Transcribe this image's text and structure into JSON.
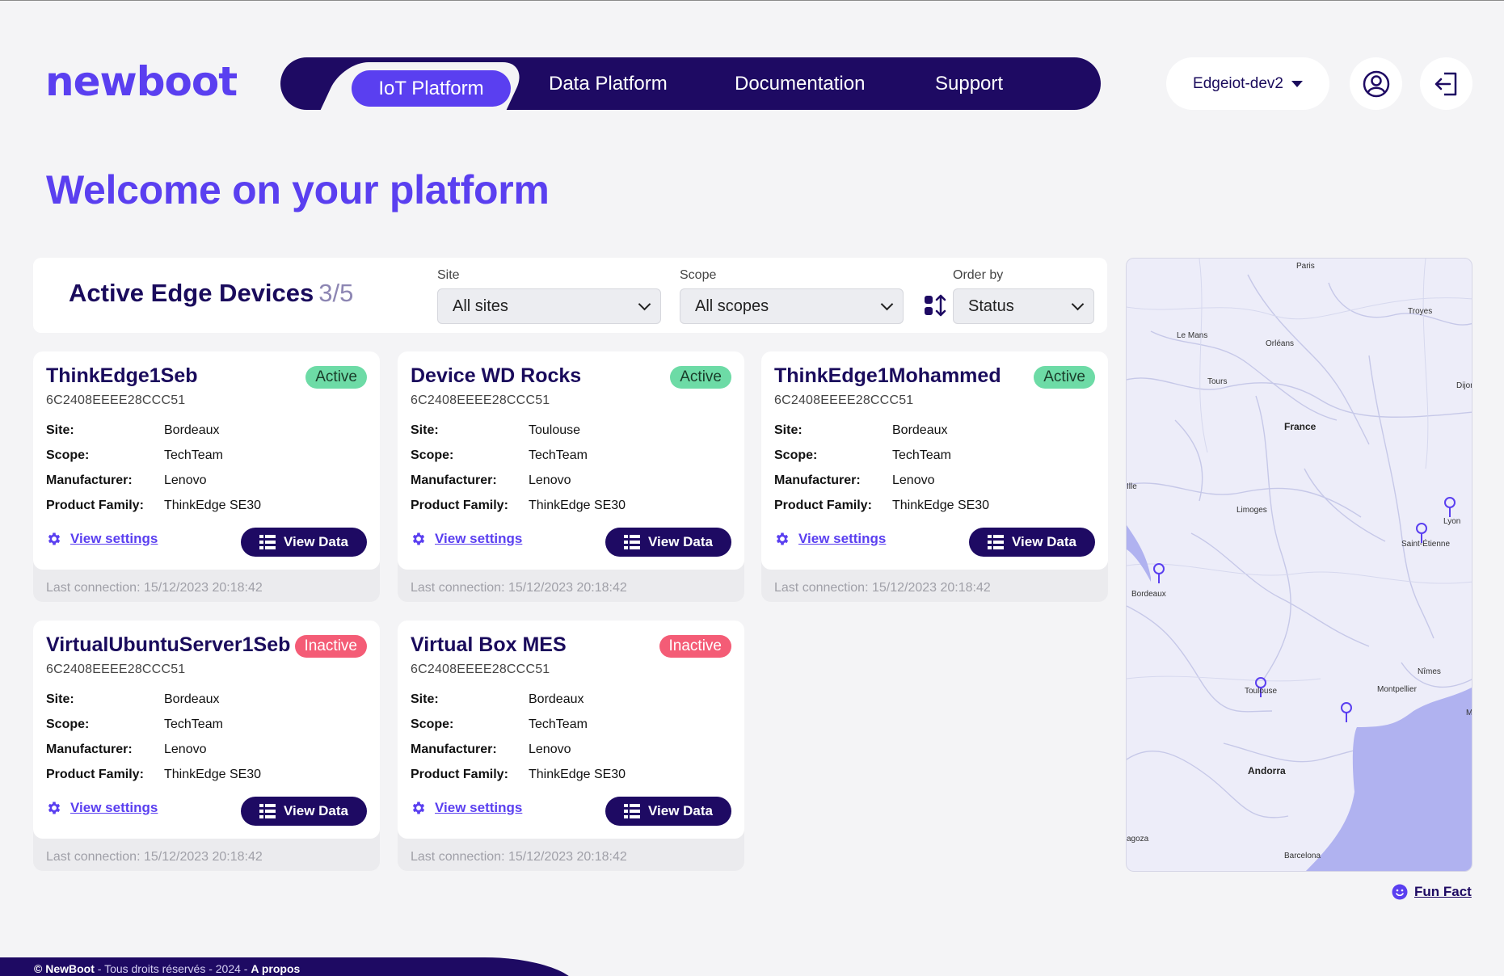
{
  "header": {
    "logo": "newboot",
    "nav": {
      "active": "IoT Platform",
      "items": [
        "Data Platform",
        "Documentation",
        "Support"
      ]
    },
    "environment": "Edgeiot-dev2"
  },
  "page_title": "Welcome on your platform",
  "filters": {
    "title": "Active Edge Devices",
    "count": "3/5",
    "site_label": "Site",
    "site_value": "All sites",
    "scope_label": "Scope",
    "scope_value": "All scopes",
    "order_label": "Order by",
    "order_value": "Status"
  },
  "card_labels": {
    "site": "Site:",
    "scope": "Scope:",
    "manufacturer": "Manufacturer:",
    "product_family": "Product Family:",
    "view_settings": "View settings",
    "view_data": "View Data"
  },
  "devices": [
    {
      "name": "ThinkEdge1Seb",
      "status": "Active",
      "id": "6C2408EEEE28CCC51",
      "site": "Bordeaux",
      "scope": "TechTeam",
      "manufacturer": "Lenovo",
      "product_family": "ThinkEdge SE30",
      "last_connection": "Last connection: 15/12/2023 20:18:42"
    },
    {
      "name": "Device WD Rocks",
      "status": "Active",
      "id": "6C2408EEEE28CCC51",
      "site": "Toulouse",
      "scope": "TechTeam",
      "manufacturer": "Lenovo",
      "product_family": "ThinkEdge SE30",
      "last_connection": "Last connection: 15/12/2023 20:18:42"
    },
    {
      "name": "ThinkEdge1Mohammed",
      "status": "Active",
      "id": "6C2408EEEE28CCC51",
      "site": "Bordeaux",
      "scope": "TechTeam",
      "manufacturer": "Lenovo",
      "product_family": "ThinkEdge SE30",
      "last_connection": "Last connection: 15/12/2023 20:18:42"
    },
    {
      "name": "VirtualUbuntuServer1Seb",
      "status": "Inactive",
      "id": "6C2408EEEE28CCC51",
      "site": "Bordeaux",
      "scope": "TechTeam",
      "manufacturer": "Lenovo",
      "product_family": "ThinkEdge SE30",
      "last_connection": "Last connection: 15/12/2023 20:18:42"
    },
    {
      "name": "Virtual Box MES",
      "status": "Inactive",
      "id": "6C2408EEEE28CCC51",
      "site": "Bordeaux",
      "scope": "TechTeam",
      "manufacturer": "Lenovo",
      "product_family": "ThinkEdge SE30",
      "last_connection": "Last connection: 15/12/2023 20:18:42"
    }
  ],
  "map": {
    "cities": [
      "Paris",
      "Troyes",
      "Le Mans",
      "Orléans",
      "Tours",
      "Dijon",
      "France",
      "Ille",
      "Limoges",
      "Lyon",
      "Saint-Étienne",
      "Bordeaux",
      "Nîmes",
      "Montpellier",
      "M",
      "Toulouse",
      "Andorra",
      "agoza",
      "Barcelona"
    ]
  },
  "fun_fact": "Fun Fact",
  "footer": {
    "brand": "© NewBoot",
    "rights": " - Tous droits réservés - 2024 - ",
    "about": "A propos"
  },
  "colors": {
    "brand": "#5a3ff0",
    "navy": "#1e0a63",
    "active": "#6ddba6",
    "inactive": "#f45c76"
  }
}
